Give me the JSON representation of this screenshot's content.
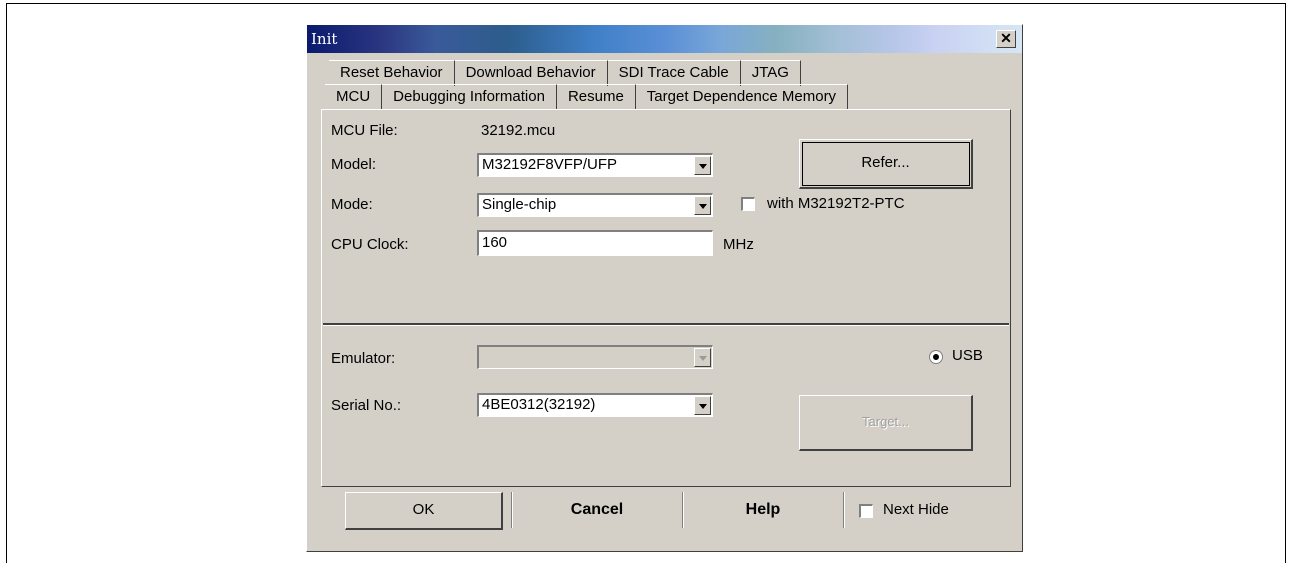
{
  "window": {
    "title": "Init"
  },
  "tabs_row1": [
    "Reset Behavior",
    "Download Behavior",
    "SDI Trace Cable",
    "JTAG"
  ],
  "tabs_row2": [
    "MCU",
    "Debugging Information",
    "Resume",
    "Target Dependence Memory"
  ],
  "active_tab": "MCU",
  "mcu": {
    "mcu_file_label": "MCU File:",
    "mcu_file_value": "32192.mcu",
    "model_label": "Model:",
    "model_value": "M32192F8VFP/UFP",
    "mode_label": "Mode:",
    "mode_value": "Single-chip",
    "cpu_clock_label": "CPU Clock:",
    "cpu_clock_value": "160",
    "cpu_clock_unit": "MHz",
    "refer_label": "Refer...",
    "ptc_checkbox_label": "with M32192T2-PTC",
    "ptc_checked": false
  },
  "emulator": {
    "emulator_label": "Emulator:",
    "emulator_value": "",
    "usb_label": "USB",
    "usb_selected": true,
    "serial_label": "Serial No.:",
    "serial_value": "4BE0312(32192)",
    "target_label": "Target..."
  },
  "footer": {
    "ok_label": "OK",
    "cancel_label": "Cancel",
    "help_label": "Help",
    "next_hide_label": "Next Hide",
    "next_hide_checked": false
  }
}
